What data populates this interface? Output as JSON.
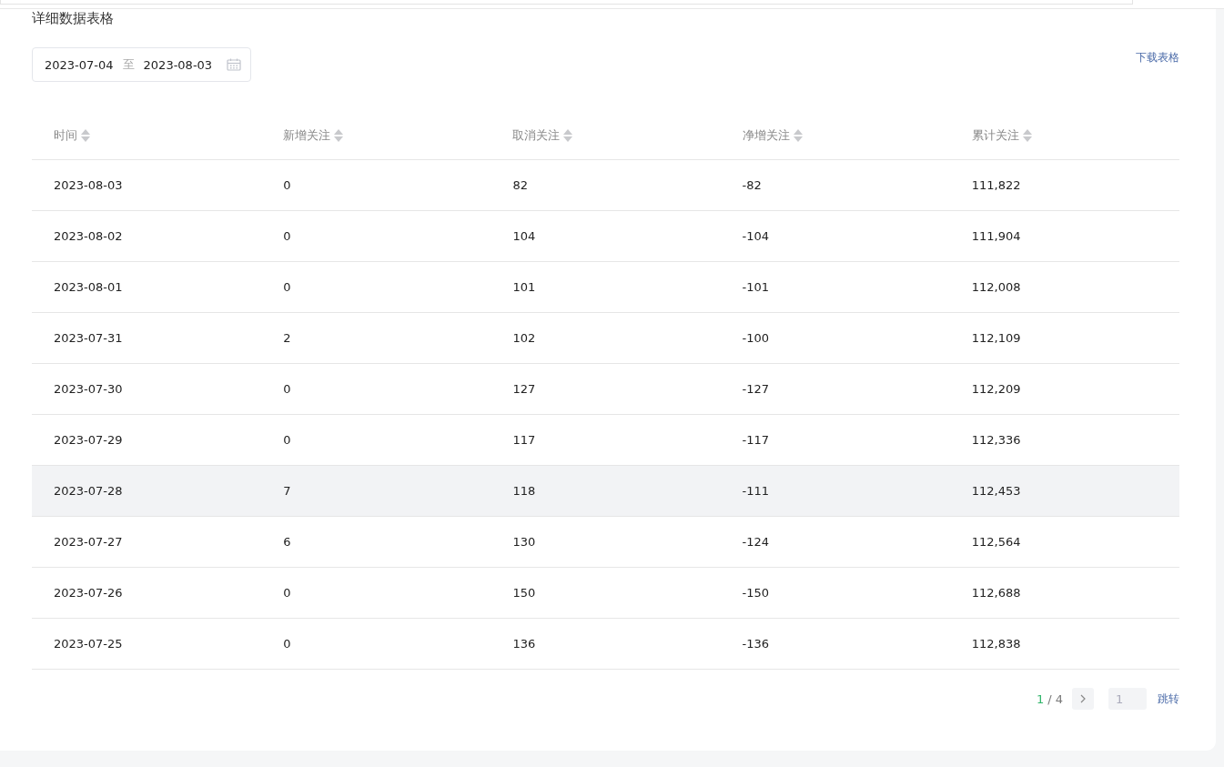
{
  "title": "详细数据表格",
  "date_range": {
    "start": "2023-07-04",
    "separator": "至",
    "end": "2023-08-03"
  },
  "download_link": "下载表格",
  "table": {
    "columns": [
      "时间",
      "新增关注",
      "取消关注",
      "净增关注",
      "累计关注"
    ],
    "rows": [
      {
        "cells": [
          "2023-08-03",
          "0",
          "82",
          "-82",
          "111,822"
        ],
        "hovered": false
      },
      {
        "cells": [
          "2023-08-02",
          "0",
          "104",
          "-104",
          "111,904"
        ],
        "hovered": false
      },
      {
        "cells": [
          "2023-08-01",
          "0",
          "101",
          "-101",
          "112,008"
        ],
        "hovered": false
      },
      {
        "cells": [
          "2023-07-31",
          "2",
          "102",
          "-100",
          "112,109"
        ],
        "hovered": false
      },
      {
        "cells": [
          "2023-07-30",
          "0",
          "127",
          "-127",
          "112,209"
        ],
        "hovered": false
      },
      {
        "cells": [
          "2023-07-29",
          "0",
          "117",
          "-117",
          "112,336"
        ],
        "hovered": false
      },
      {
        "cells": [
          "2023-07-28",
          "7",
          "118",
          "-111",
          "112,453"
        ],
        "hovered": true
      },
      {
        "cells": [
          "2023-07-27",
          "6",
          "130",
          "-124",
          "112,564"
        ],
        "hovered": false
      },
      {
        "cells": [
          "2023-07-26",
          "0",
          "150",
          "-150",
          "112,688"
        ],
        "hovered": false
      },
      {
        "cells": [
          "2023-07-25",
          "0",
          "136",
          "-136",
          "112,838"
        ],
        "hovered": false
      }
    ]
  },
  "pagination": {
    "current": "1",
    "total": "/ 4",
    "page_input": "1",
    "jump": "跳转"
  }
}
